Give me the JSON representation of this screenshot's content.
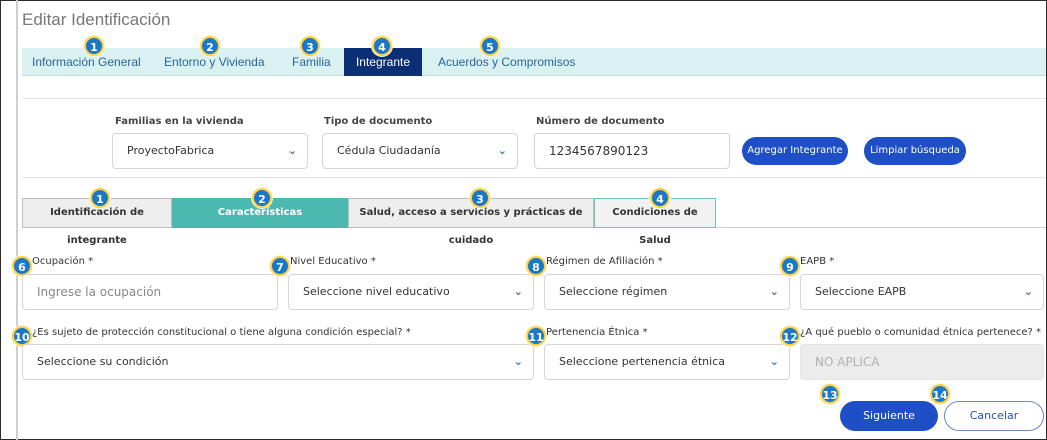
{
  "page": {
    "title": "Editar Identificación"
  },
  "main_tabs": [
    {
      "label": "Información General",
      "badge": "1"
    },
    {
      "label": "Entorno y Vivienda",
      "badge": "2"
    },
    {
      "label": "Familia",
      "badge": "3"
    },
    {
      "label": "Integrante",
      "badge": "4",
      "active": true
    },
    {
      "label": "Acuerdos y Compromisos",
      "badge": "5"
    }
  ],
  "search": {
    "familias_label": "Familias en la vivienda",
    "familias_value": "ProyectoFabrica",
    "tipo_doc_label": "Tipo de documento",
    "tipo_doc_value": "Cédula Ciudadanía",
    "num_doc_label": "Número de documento",
    "num_doc_value": "1234567890123",
    "add_button": "Agregar Integrante",
    "clear_button": "Limpiar búsqueda"
  },
  "sub_tabs": [
    {
      "label": "Identificación de integrante",
      "badge": "1"
    },
    {
      "label": "Características socioeconómicas",
      "badge": "2",
      "active": true
    },
    {
      "label": "Salud, acceso a servicios y prácticas de cuidado",
      "badge": "3"
    },
    {
      "label": "Condiciones de Salud",
      "badge": "4"
    }
  ],
  "form": {
    "ocupacion": {
      "badge": "6",
      "label": "Ocupación *",
      "placeholder": "Ingrese la ocupación"
    },
    "nivel_educativo": {
      "badge": "7",
      "label": "Nivel Educativo *",
      "value": "Seleccione nivel educativo"
    },
    "regimen": {
      "badge": "8",
      "label": "Régimen de Afiliación *",
      "value": "Seleccione régimen"
    },
    "eapb": {
      "badge": "9",
      "label": "EAPB *",
      "value": "Seleccione EAPB"
    },
    "proteccion": {
      "badge": "10",
      "label": "¿Es sujeto de protección constitucional o tiene alguna condición especial? *",
      "value": "Seleccione su condición"
    },
    "etnica": {
      "badge": "11",
      "label": "Pertenencia Étnica *",
      "value": "Seleccione pertenencia étnica"
    },
    "pueblo": {
      "badge": "12",
      "label": "¿A qué pueblo o comunidad étnica pertenece? *",
      "value": "NO APLICA"
    }
  },
  "actions": {
    "next_badge": "13",
    "next_label": "Siguiente",
    "cancel_badge": "14",
    "cancel_label": "Cancelar"
  },
  "colors": {
    "primary": "#1f4fc6",
    "tab_active": "#0b2f74",
    "subtab_active": "#4cb9b0",
    "badge": "#1b78c8",
    "tabbar_bg": "#daf1f2"
  }
}
